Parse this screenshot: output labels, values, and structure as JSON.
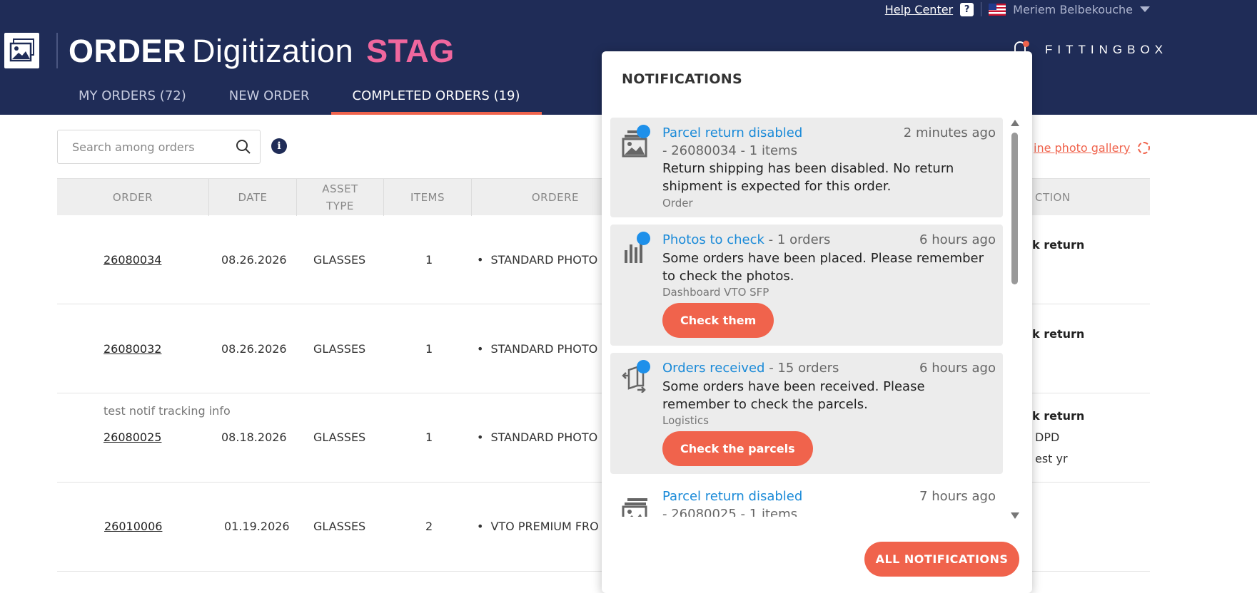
{
  "topbar": {
    "help_center": "Help Center",
    "help_icon": "?",
    "flag_icon": "us-flag-icon",
    "user_name": "Meriem Belbekouche"
  },
  "header": {
    "title_strong": "ORDER",
    "title_light": "Digitization",
    "env_badge": "STAG",
    "brand": "FITTINGBOX"
  },
  "tabs": [
    {
      "label": "MY ORDERS (72)"
    },
    {
      "label": "NEW ORDER"
    },
    {
      "label": "COMPLETED ORDERS (19)",
      "active": true
    }
  ],
  "search": {
    "placeholder": "Search among orders"
  },
  "gallery_link": "ine photo gallery",
  "table": {
    "headers": {
      "order": "ORDER",
      "date": "DATE",
      "asset_type_1": "ASSET",
      "asset_type_2": "TYPE",
      "items": "ITEMS",
      "ordered": "ORDERE",
      "action": "CTION"
    },
    "rows": [
      {
        "order": "26080034",
        "date": "08.26.2026",
        "asset": "GLASSES",
        "items": "1",
        "product": "STANDARD PHOTO",
        "action": "k return"
      },
      {
        "order": "26080032",
        "date": "08.26.2026",
        "asset": "GLASSES",
        "items": "1",
        "product": "STANDARD PHOTO",
        "action": "k return"
      },
      {
        "note": "test notif tracking info",
        "order": "26080025",
        "date": "08.18.2026",
        "asset": "GLASSES",
        "items": "1",
        "product": "STANDARD PHOTO",
        "action": "k return",
        "action_line2": "DPD",
        "action_line3": "est yr"
      },
      {
        "order": "26010006",
        "date": "01.19.2026",
        "asset": "GLASSES",
        "items": "2",
        "product": "VTO PREMIUM FRO"
      }
    ]
  },
  "notifications": {
    "title": "NOTIFICATIONS",
    "items": [
      {
        "title": "Parcel return disabled",
        "time": "2 minutes ago",
        "meta": "- 26080034 - 1 items",
        "body": "Return shipping has been disabled. No return shipment is expected for this order.",
        "category": "Order",
        "icon": "image-stack-icon",
        "unread": true
      },
      {
        "title": "Photos to check",
        "meta": "- 1 orders",
        "time": "6 hours ago",
        "body": "Some orders have been placed. Please remember to check the photos.",
        "category": "Dashboard VTO SFP",
        "button": "Check them",
        "icon": "bar-chart-icon",
        "unread": true
      },
      {
        "title": "Orders received",
        "meta": "- 15 orders",
        "time": "6 hours ago",
        "body": "Some orders have been received. Please remember to check the parcels.",
        "category": "Logistics",
        "button": "Check the parcels",
        "icon": "parcel-exchange-icon",
        "unread": true
      },
      {
        "title": "Parcel return disabled",
        "time": "7 hours ago",
        "meta": "- 26080025 - 1 items",
        "icon": "image-stack-icon",
        "unread": false
      }
    ],
    "all_button": "ALL NOTIFICATIONS"
  },
  "colors": {
    "header_bg": "#1f2c57",
    "accent": "#f0634c",
    "env_badge": "#f0679e",
    "link_blue": "#1a8ad8",
    "unread_dot": "#1e90ea"
  }
}
